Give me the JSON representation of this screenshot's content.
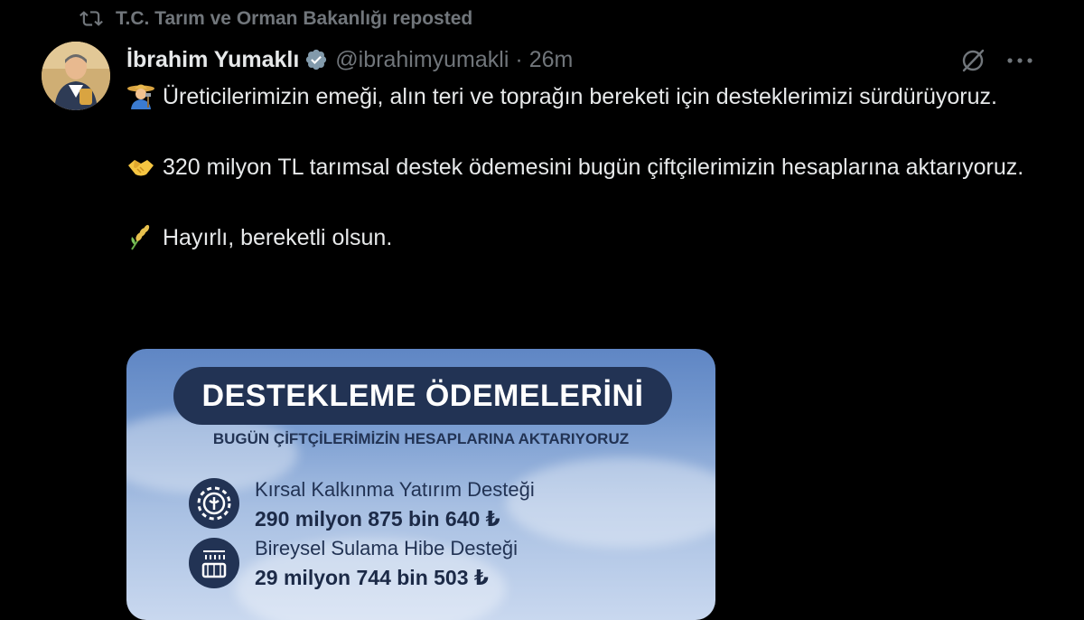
{
  "repost": {
    "label": "T.C. Tarım ve Orman Bakanlığı reposted"
  },
  "tweet": {
    "author_name": "İbrahim Yumaklı",
    "handle": "@ibrahimyumakli",
    "separator": "·",
    "time": "26m",
    "paragraphs": [
      "Üreticilerimizin emeği, alın teri ve toprağın bereketi için desteklerimizi sürdürüyoruz.",
      "320 milyon TL tarımsal destek ödemesini bugün çiftçilerimizin hesaplarına aktarıyoruz.",
      "Hayırlı, bereketli olsun."
    ],
    "emojis": [
      "farmer-emoji",
      "handshake-emoji",
      "rice-plant-emoji"
    ]
  },
  "media": {
    "banner_title": "DESTEKLEME ÖDEMELERİNİ",
    "subtitle": "BUGÜN ÇİFTÇİLERİMİZİN HESAPLARINA AKTARIYORUZ",
    "items": [
      {
        "label": "Kırsal Kalkınma Yatırım Desteği",
        "amount": "290 milyon 875 bin 640 ₺",
        "icon": "gear-tractor-icon"
      },
      {
        "label": "Bireysel Sulama Hibe Desteği",
        "amount": "29 milyon 744 bin 503 ₺",
        "icon": "irrigation-icon"
      }
    ]
  },
  "colors": {
    "background": "#000000",
    "text": "#e7e9ea",
    "muted": "#71767b",
    "verified": "#829aab",
    "banner": "#223354"
  }
}
